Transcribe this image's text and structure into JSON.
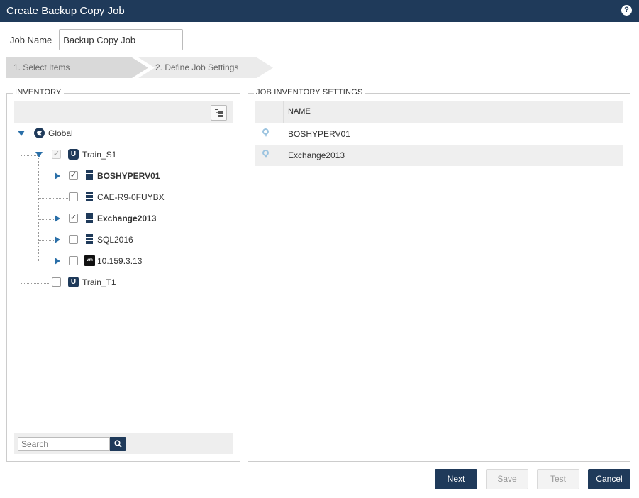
{
  "window": {
    "title": "Create Backup Copy Job",
    "help_glyph": "?"
  },
  "job_name": {
    "label": "Job Name",
    "value": "Backup Copy Job"
  },
  "wizard": {
    "steps": [
      {
        "label": "1. Select Items",
        "active": true
      },
      {
        "label": "2. Define Job Settings",
        "active": false
      }
    ]
  },
  "inventory": {
    "legend": "INVENTORY",
    "tree": [
      {
        "label": "Global",
        "icon": "globe-icon",
        "expanded": true
      },
      {
        "label": "Train_S1",
        "icon": "unitrends-appliance-icon",
        "checked": true,
        "disabled": true,
        "expanded": true
      },
      {
        "label": "BOSHYPERV01",
        "icon": "server-icon",
        "checked": true,
        "bold": true
      },
      {
        "label": "CAE-R9-0FUYBX",
        "icon": "server-icon",
        "checked": false
      },
      {
        "label": "Exchange2013",
        "icon": "server-icon",
        "checked": true,
        "bold": true
      },
      {
        "label": "SQL2016",
        "icon": "server-icon",
        "checked": false
      },
      {
        "label": "10.159.3.13",
        "icon": "vmware-icon",
        "checked": false,
        "icon_text": "vm"
      },
      {
        "label": "Train_T1",
        "icon": "unitrends-appliance-icon",
        "checked": false
      }
    ],
    "search": {
      "placeholder": "Search"
    }
  },
  "settings": {
    "legend": "JOB INVENTORY SETTINGS",
    "columns": [
      "NAME"
    ],
    "rows": [
      {
        "name": "BOSHYPERV01",
        "icon": "location-pin-icon"
      },
      {
        "name": "Exchange2013",
        "icon": "location-pin-icon"
      }
    ]
  },
  "buttons": {
    "next": "Next",
    "save": "Save",
    "test": "Test",
    "cancel": "Cancel"
  },
  "colors": {
    "brand": "#1f3a5a",
    "tree_twisty": "#2a6fa8",
    "row_alt": "#efefef"
  }
}
